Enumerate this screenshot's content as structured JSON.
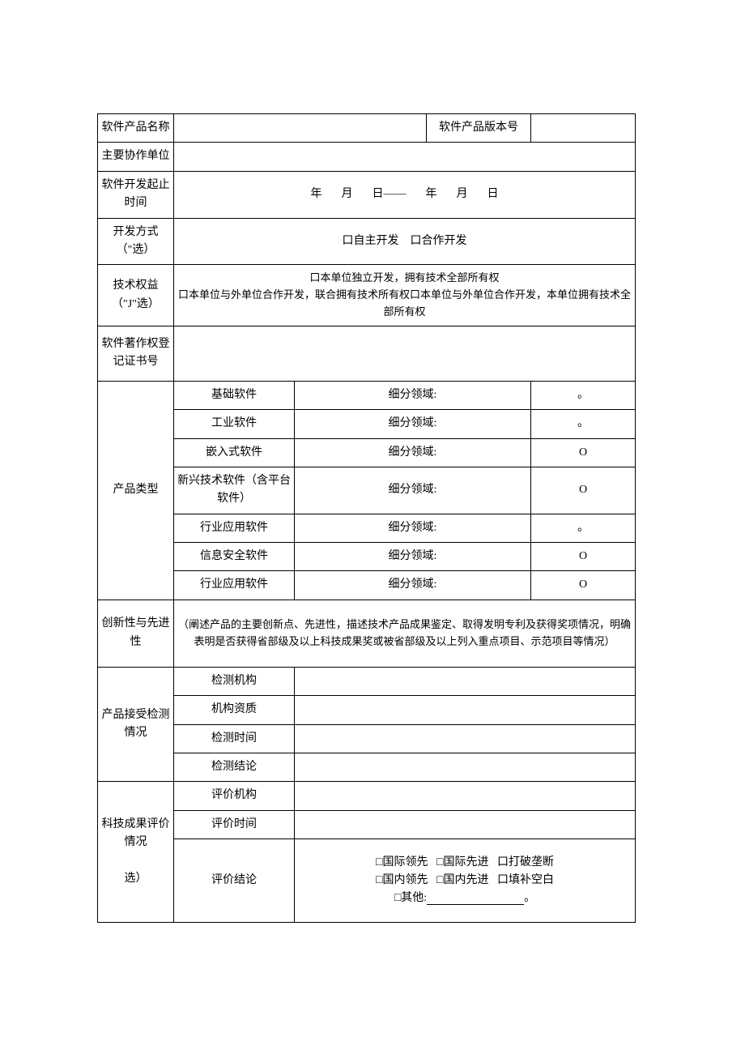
{
  "rows": {
    "r1_label": "软件产品名称",
    "r1_mid": "软件产品版本号",
    "r2_label": "主要协作单位",
    "r3_label": "软件开发起止时间",
    "r3_y1": "年",
    "r3_m1": "月",
    "r3_d1": "日——",
    "r3_y2": "年",
    "r3_m2": "月",
    "r3_d2": "日",
    "r4_label": "开发方式（\"选）",
    "r4_opt1": "口自主开发",
    "r4_opt2": "口合作开发",
    "r5_label": "技术权益（\"J\"选）",
    "r5_line1": "口本单位独立开发，拥有技术全部所有权",
    "r5_line2": "口本单位与外单位合作开发，联合拥有技术所有权口本单位与外单位合作开发，本单位拥有技术全部所有权",
    "r6_label": "软件著作权登记证书号",
    "r7_label": "产品类型",
    "pt1": "基础软件",
    "pt2": "工业软件",
    "pt3": "嵌入式软件",
    "pt4": "新兴技术软件（含平台软件）",
    "pt5": "行业应用软件",
    "pt6": "信息安全软件",
    "pt7": "行业应用软件",
    "sub": "细分领域:",
    "dot": "。",
    "o": "O",
    "r8_label": "创新性与先进性",
    "r8_text": "（阐述产品的主要创新点、先进性，描述技术产品成果鉴定、取得发明专利及获得奖项情况，明确表明是否获得省部级及以上科技成果奖或被省部级及以上列入重点项目、示范项目等情况）",
    "r9_label": "产品接受检测情况",
    "d1": "检测机构",
    "d2": "机构资质",
    "d3": "检测时间",
    "d4": "检测结论",
    "r10_label": "科技成果评价情况\n\n选）",
    "e1": "评价机构",
    "e2": "评价时间",
    "e3": "评价结论",
    "ev_a": "□国际领先",
    "ev_b": "□国际先进",
    "ev_c": "口打破垄断",
    "ev_d": "□国内领先",
    "ev_e": "□国内先进",
    "ev_f": "口填补空白",
    "ev_g": "□其他:",
    "ev_end": "。"
  }
}
